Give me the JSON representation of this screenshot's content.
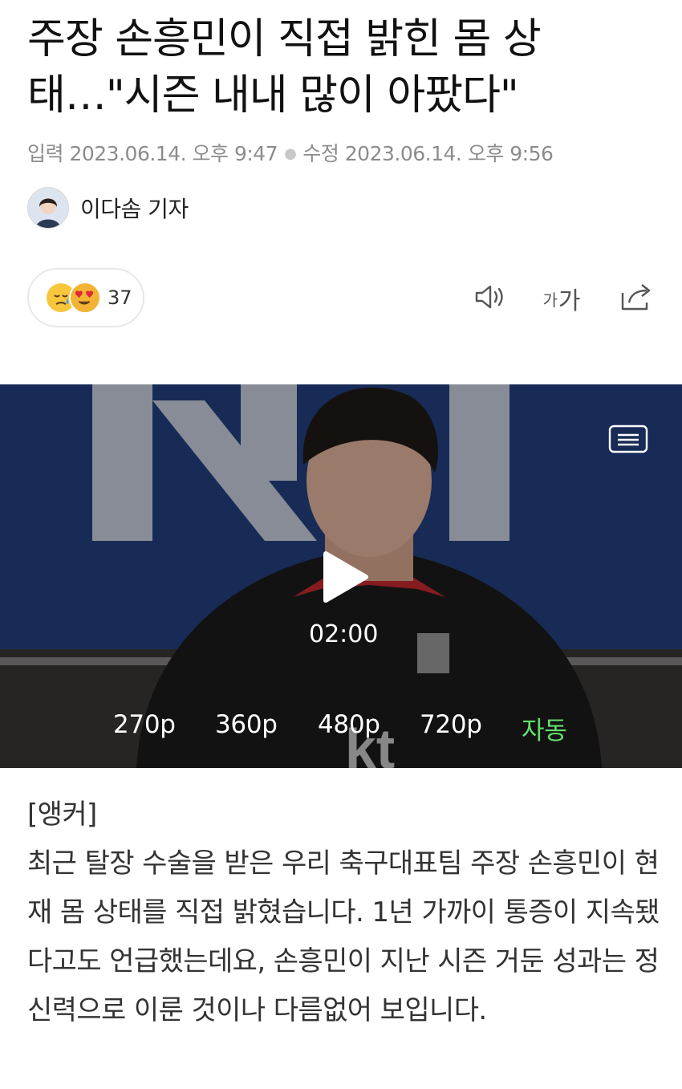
{
  "article": {
    "title": "주장 손흥민이 직접 밝힌 몸 상태…\"시즌 내내 많이 아팠다\"",
    "input_label": "입력",
    "input_time": "2023.06.14. 오후 9:47",
    "modified_label": "수정",
    "modified_time": "2023.06.14. 오후 9:56",
    "reporter": "이다솜 기자"
  },
  "reactions": {
    "count": "37",
    "emoji": [
      "sad-face-icon",
      "heart-eyes-icon"
    ]
  },
  "toolbar": {
    "audio_icon": "speaker-icon",
    "font_size_label_small": "가",
    "font_size_label_large": "가",
    "share_icon": "share-icon"
  },
  "video": {
    "duration": "02:00",
    "menu_icon": "menu-icon",
    "play_icon": "play-icon",
    "quality_options": [
      "270p",
      "360p",
      "480p",
      "720p",
      "자동"
    ],
    "selected_quality": "자동",
    "selected_color": "#63e06a"
  },
  "body": {
    "tag": "[앵커]",
    "paragraph": "최근 탈장 수술을 받은 우리 축구대표팀 주장 손흥민이 현재 몸 상태를 직접 밝혔습니다. 1년 가까이 통증이 지속됐다고도 언급했는데요, 손흥민이 지난 시즌 거둔 성과는 정신력으로 이룬 것이나 다름없어 보입니다."
  }
}
